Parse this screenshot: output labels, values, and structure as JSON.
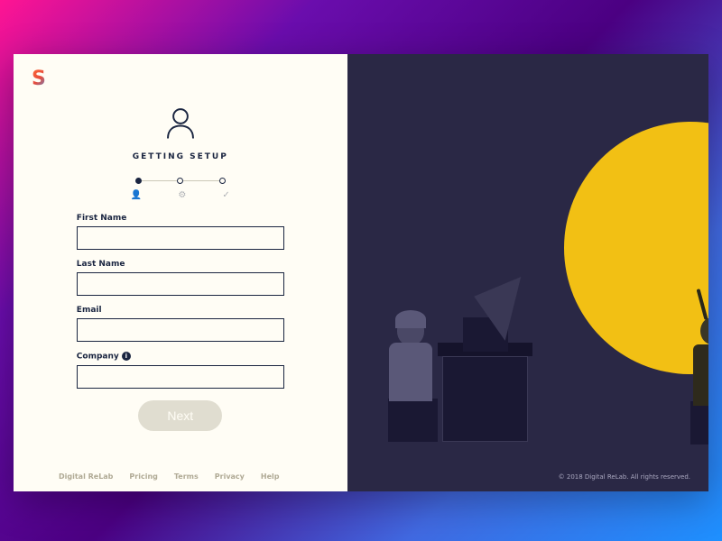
{
  "logo": "S",
  "form": {
    "title": "GETTING SETUP",
    "fields": {
      "firstName": {
        "label": "First Name",
        "value": ""
      },
      "lastName": {
        "label": "Last Name",
        "value": ""
      },
      "email": {
        "label": "Email",
        "value": ""
      },
      "company": {
        "label": "Company",
        "value": ""
      }
    },
    "nextButton": "Next"
  },
  "footer": {
    "links": [
      "Digital ReLab",
      "Pricing",
      "Terms",
      "Privacy",
      "Help"
    ]
  },
  "copyright": "© 2018 Digital ReLab. All rights reserved."
}
